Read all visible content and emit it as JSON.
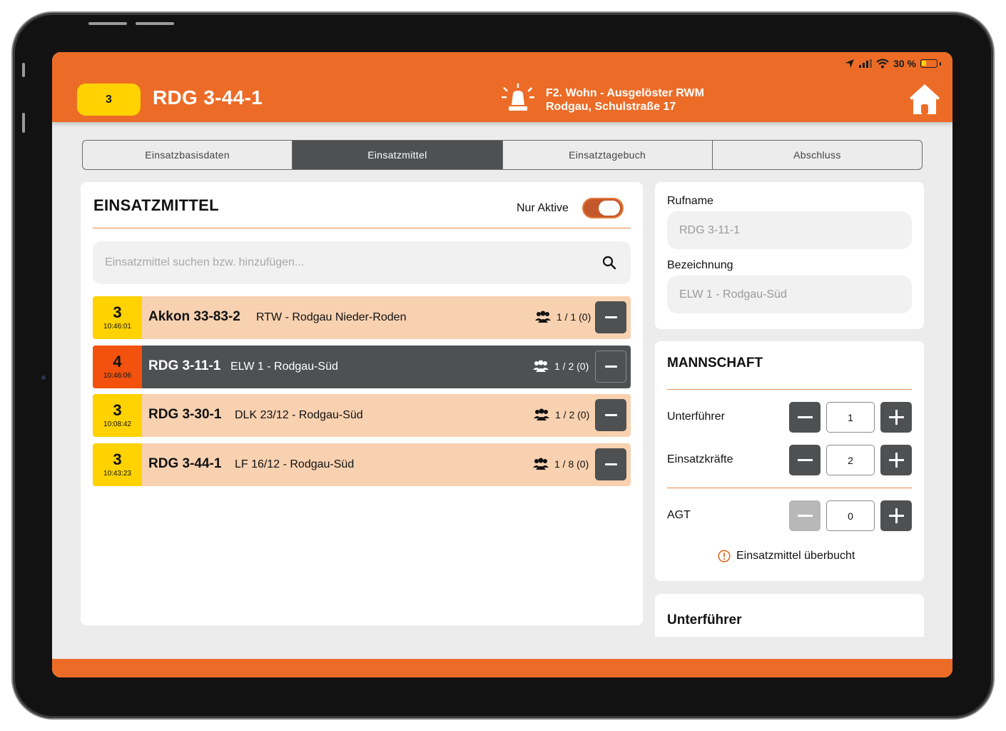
{
  "status_bar": {
    "battery_percent_text": "30 %",
    "battery_level": 0.3
  },
  "header": {
    "status_code": "3",
    "callsign": "RDG 3-44-1",
    "incident_line1": "F2. Wohn - Ausgelöster RWM",
    "incident_line2": "Rodgau, Schulstraße 17",
    "colors": {
      "header_bg": "#ec6c27",
      "status_yellow": "#ffd200"
    }
  },
  "tabs": [
    {
      "label": "Einsatzbasisdaten",
      "active": false
    },
    {
      "label": "Einsatzmittel",
      "active": true
    },
    {
      "label": "Einsatztagebuch",
      "active": false
    },
    {
      "label": "Abschluss",
      "active": false
    }
  ],
  "einsatzmittel": {
    "title": "EINSATZMITTEL",
    "toggle_label": "Nur Aktive",
    "toggle_on": true,
    "search_placeholder": "Einsatzmittel suchen bzw. hinzufügen...",
    "rows": [
      {
        "status": "3",
        "time": "10:46:01",
        "name": "Akkon 33-83-2",
        "desc": "RTW - Rodgau Nieder-Roden",
        "crew": "1 / 1 (0)",
        "selected": false
      },
      {
        "status": "4",
        "time": "10:46:06",
        "name": "RDG 3-11-1",
        "desc": "ELW 1 - Rodgau-Süd",
        "crew": "1 / 2 (0)",
        "selected": true
      },
      {
        "status": "3",
        "time": "10:08:42",
        "name": "RDG 3-30-1",
        "desc": "DLK 23/12 - Rodgau-Süd",
        "crew": "1 / 2 (0)",
        "selected": false
      },
      {
        "status": "3",
        "time": "10:43:23",
        "name": "RDG 3-44-1",
        "desc": "LF 16/12 - Rodgau-Süd",
        "crew": "1 / 8 (0)",
        "selected": false
      }
    ]
  },
  "details": {
    "rufname_label": "Rufname",
    "rufname_value": "RDG 3-11-1",
    "bezeichnung_label": "Bezeichnung",
    "bezeichnung_value": "ELW 1 - Rodgau-Süd"
  },
  "mannschaft": {
    "title": "MANNSCHAFT",
    "unterfuehrer_label": "Unterführer",
    "unterfuehrer_value": "1",
    "einsatzkraefte_label": "Einsatzkräfte",
    "einsatzkraefte_value": "2",
    "agt_label": "AGT",
    "agt_value": "0",
    "warning": "Einsatzmittel überbucht"
  },
  "unterfuehrer_section": {
    "title": "Unterführer"
  }
}
